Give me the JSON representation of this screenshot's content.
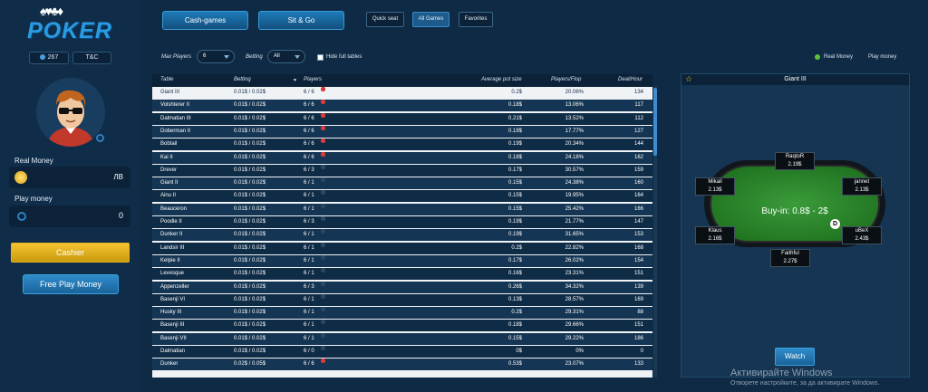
{
  "logo": {
    "cards": "♠♥♣♦",
    "text": "POKER"
  },
  "user": {
    "online": "267",
    "tc": "T&C"
  },
  "balances": {
    "real_label": "Real Money",
    "real_value": "ЛВ",
    "play_label": "Play money",
    "play_value": "0"
  },
  "buttons": {
    "cashier": "Cashier",
    "free_play": "Free Play Money",
    "watch": "Watch"
  },
  "top_tabs": {
    "cash": "Cash-games",
    "sitgo": "Sit & Go",
    "quick": "Quick seat",
    "all": "All Games",
    "fav": "Favorites"
  },
  "filters": {
    "max_label": "Max Players",
    "max_value": "6",
    "betting_label": "Betting",
    "betting_value": "All",
    "hide_label": "Hide full tables"
  },
  "money_mode": {
    "real": "Real Money",
    "play": "Play money"
  },
  "table": {
    "headers": {
      "table": "Table",
      "betting": "Betting",
      "players": "Players",
      "avg_pot": "Average pot size",
      "players_flop": "Players/Flop",
      "deal_hour": "Deal/Hour"
    },
    "rows": [
      {
        "name": "Giant III",
        "bet": "0.01$ / 0.02$",
        "players": "6 / 6",
        "seated": 6,
        "pot": "0.2$",
        "flop": "20.06%",
        "dph": "134"
      },
      {
        "name": "Volshterer II",
        "bet": "0.01$ / 0.02$",
        "players": "6 / 6",
        "seated": 6,
        "pot": "0.18$",
        "flop": "13.06%",
        "dph": "117"
      },
      {
        "name": "Dalmatian III",
        "bet": "0.01$ / 0.02$",
        "players": "6 / 6",
        "seated": 6,
        "pot": "0.21$",
        "flop": "13.52%",
        "dph": "112"
      },
      {
        "name": "Doberman II",
        "bet": "0.01$ / 0.02$",
        "players": "6 / 6",
        "seated": 6,
        "pot": "0.19$",
        "flop": "17.77%",
        "dph": "127"
      },
      {
        "name": "Bobtail",
        "bet": "0.01$ / 0.02$",
        "players": "6 / 6",
        "seated": 6,
        "pot": "0.19$",
        "flop": "20.34%",
        "dph": "144"
      },
      {
        "name": "Kai II",
        "bet": "0.01$ / 0.02$",
        "players": "6 / 6",
        "seated": 6,
        "pot": "0.18$",
        "flop": "24.18%",
        "dph": "162"
      },
      {
        "name": "Drever",
        "bet": "0.01$ / 0.02$",
        "players": "6 / 3",
        "seated": 3,
        "pot": "0.17$",
        "flop": "30.57%",
        "dph": "159"
      },
      {
        "name": "Giant II",
        "bet": "0.01$ / 0.02$",
        "players": "6 / 1",
        "seated": 1,
        "pot": "0.15$",
        "flop": "24.38%",
        "dph": "160"
      },
      {
        "name": "Ainu II",
        "bet": "0.01$ / 0.02$",
        "players": "6 / 1",
        "seated": 1,
        "pot": "0.15$",
        "flop": "19.95%",
        "dph": "164"
      },
      {
        "name": "Beauceron",
        "bet": "0.01$ / 0.02$",
        "players": "6 / 1",
        "seated": 1,
        "pot": "0.15$",
        "flop": "25.42%",
        "dph": "166"
      },
      {
        "name": "Poodle II",
        "bet": "0.01$ / 0.02$",
        "players": "6 / 3",
        "seated": 3,
        "pot": "0.19$",
        "flop": "21.77%",
        "dph": "147"
      },
      {
        "name": "Dunker II",
        "bet": "0.01$ / 0.02$",
        "players": "6 / 1",
        "seated": 1,
        "pot": "0.19$",
        "flop": "31.65%",
        "dph": "153"
      },
      {
        "name": "Landsir III",
        "bet": "0.01$ / 0.02$",
        "players": "6 / 1",
        "seated": 1,
        "pot": "0.2$",
        "flop": "22.82%",
        "dph": "168"
      },
      {
        "name": "Kelpie II",
        "bet": "0.01$ / 0.02$",
        "players": "6 / 1",
        "seated": 1,
        "pot": "0.17$",
        "flop": "26.02%",
        "dph": "154"
      },
      {
        "name": "Levesque",
        "bet": "0.01$ / 0.02$",
        "players": "6 / 1",
        "seated": 1,
        "pot": "0.16$",
        "flop": "23.31%",
        "dph": "151"
      },
      {
        "name": "Appenzeller",
        "bet": "0.01$ / 0.02$",
        "players": "6 / 3",
        "seated": 3,
        "pot": "0.26$",
        "flop": "34.32%",
        "dph": "139"
      },
      {
        "name": "Basenji VI",
        "bet": "0.01$ / 0.02$",
        "players": "6 / 1",
        "seated": 1,
        "pot": "0.13$",
        "flop": "28.57%",
        "dph": "169"
      },
      {
        "name": "Husky III",
        "bet": "0.01$ / 0.02$",
        "players": "6 / 1",
        "seated": 1,
        "pot": "0.2$",
        "flop": "29.31%",
        "dph": "88"
      },
      {
        "name": "Basenji III",
        "bet": "0.01$ / 0.02$",
        "players": "6 / 1",
        "seated": 1,
        "pot": "0.18$",
        "flop": "29.66%",
        "dph": "151"
      },
      {
        "name": "Basenji VII",
        "bet": "0.01$ / 0.02$",
        "players": "6 / 1",
        "seated": 1,
        "pot": "0.15$",
        "flop": "29.22%",
        "dph": "186"
      },
      {
        "name": "Dalmatian",
        "bet": "0.01$ / 0.02$",
        "players": "6 / 0",
        "seated": 0,
        "pot": "0$",
        "flop": "0%",
        "dph": "0"
      },
      {
        "name": "Dunker",
        "bet": "0.02$ / 0.05$",
        "players": "6 / 6",
        "seated": 6,
        "pot": "0.53$",
        "flop": "23.07%",
        "dph": "133"
      }
    ]
  },
  "preview": {
    "title": "Giant III",
    "buyin": "Buy-in: 0.8$ - 2$",
    "dealer": "D",
    "seats": [
      {
        "name": "RaqtoR",
        "stack": "2.19$"
      },
      {
        "name": "Mikail",
        "stack": "2.13$"
      },
      {
        "name": "jannet",
        "stack": "2.13$"
      },
      {
        "name": "Klaus",
        "stack": "2.16$"
      },
      {
        "name": "uBeX",
        "stack": "2.43$"
      },
      {
        "name": "Faithful",
        "stack": "2.27$"
      }
    ]
  },
  "watermark": {
    "line1": "Активирайте Windows",
    "line2": "Отворете настройките, за да активирате Windows."
  },
  "colors": {
    "accent": "#2a9be3",
    "gold": "#f3c332",
    "seat_red": "#d93a3a",
    "seat_blue": "#4aa0e0",
    "selected_row": "#f0f3f6"
  }
}
